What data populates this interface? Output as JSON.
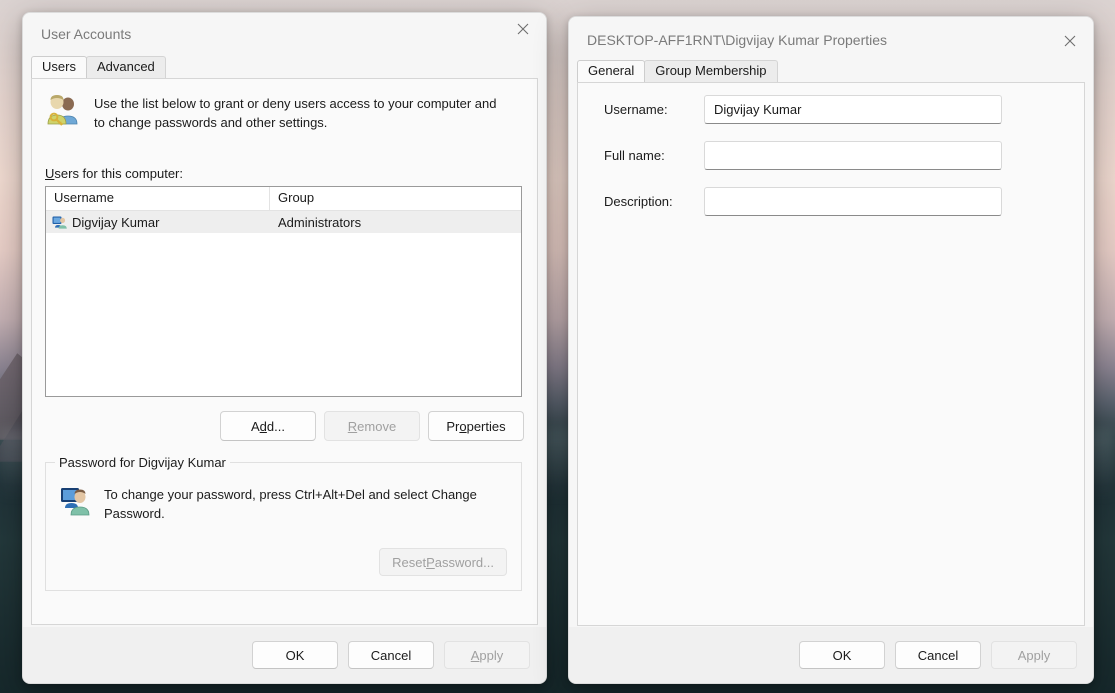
{
  "desktop": {
    "wallpaper_description": "mountain-lake-sunset"
  },
  "user_accounts": {
    "title": "User Accounts",
    "close_icon": "close-icon",
    "tabs": [
      {
        "label": "Users",
        "active": true
      },
      {
        "label": "Advanced",
        "active": false
      }
    ],
    "intro": {
      "icon": "two-users-key-icon",
      "text": "Use the list below to grant or deny users access to your computer and to change passwords and other settings."
    },
    "list_label": {
      "accesskey": "U",
      "rest": "sers for this computer:"
    },
    "listview": {
      "columns": [
        "Username",
        "Group"
      ],
      "rows": [
        {
          "icon": "user-monitor-icon",
          "username": "Digvijay Kumar",
          "group": "Administrators",
          "selected": true
        }
      ]
    },
    "list_buttons": [
      {
        "label_pre": "A",
        "accesskey": "d",
        "label_post": "d...",
        "disabled": false,
        "name": "add-button"
      },
      {
        "label_pre": "",
        "accesskey": "R",
        "label_post": "emove",
        "disabled": true,
        "name": "remove-button"
      },
      {
        "label_pre": "Pr",
        "accesskey": "o",
        "label_post": "perties",
        "disabled": false,
        "name": "properties-button"
      }
    ],
    "password_group": {
      "title": "Password for Digvijay Kumar",
      "icon": "user-monitor-icon",
      "text": "To change your password, press Ctrl+Alt+Del and select Change Password.",
      "reset_button": {
        "label_pre": "Reset ",
        "accesskey": "P",
        "label_post": "assword...",
        "disabled": true
      }
    },
    "footer_buttons": [
      {
        "label_pre": "OK",
        "accesskey": "",
        "label_post": "",
        "disabled": false,
        "name": "ok-button"
      },
      {
        "label_pre": "Cancel",
        "accesskey": "",
        "label_post": "",
        "disabled": false,
        "name": "cancel-button"
      },
      {
        "label_pre": "",
        "accesskey": "A",
        "label_post": "pply",
        "disabled": true,
        "name": "apply-button"
      }
    ]
  },
  "properties": {
    "title": "DESKTOP-AFF1RNT\\Digvijay Kumar Properties",
    "close_icon": "close-icon",
    "tabs": [
      {
        "label": "General",
        "active": true
      },
      {
        "label": "Group Membership",
        "active": false
      }
    ],
    "fields": [
      {
        "label": "Username:",
        "value": "Digvijay Kumar",
        "placeholder": "",
        "name": "username-field"
      },
      {
        "label": "Full name:",
        "value": "",
        "placeholder": "",
        "name": "full-name-field"
      },
      {
        "label": "Description:",
        "value": "",
        "placeholder": "",
        "name": "description-field"
      }
    ],
    "footer_buttons": [
      {
        "label_pre": "OK",
        "accesskey": "",
        "label_post": "",
        "disabled": false,
        "name": "ok-button"
      },
      {
        "label_pre": "Cancel",
        "accesskey": "",
        "label_post": "",
        "disabled": false,
        "name": "cancel-button"
      },
      {
        "label_pre": "Apply",
        "accesskey": "",
        "label_post": "",
        "disabled": true,
        "name": "apply-button"
      }
    ]
  },
  "colors": {
    "dialog_bg": "#f6f6f6",
    "panel_bg": "#fafafa",
    "footer_bg": "#f0f0f0",
    "selection": "#eeeeee",
    "title_text": "#7a7a7a",
    "disabled_text": "#a0a0a0"
  }
}
